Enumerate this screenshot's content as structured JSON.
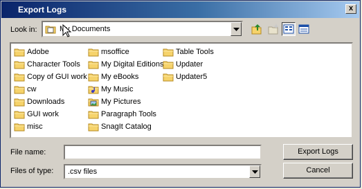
{
  "window": {
    "title": "Export Logs",
    "close_label": "x"
  },
  "lookin": {
    "label": "Look in:",
    "value": "My Documents"
  },
  "toolbar": {
    "icons": [
      "up-folder-icon",
      "new-folder-icon",
      "list-view-icon",
      "details-view-icon"
    ]
  },
  "files": [
    {
      "name": "Adobe",
      "icon": "folder-icon"
    },
    {
      "name": "Character Tools",
      "icon": "folder-icon"
    },
    {
      "name": "Copy of GUI work",
      "icon": "folder-icon"
    },
    {
      "name": "cw",
      "icon": "folder-icon"
    },
    {
      "name": "Downloads",
      "icon": "folder-icon"
    },
    {
      "name": "GUI work",
      "icon": "folder-icon"
    },
    {
      "name": "misc",
      "icon": "folder-icon"
    },
    {
      "name": "msoffice",
      "icon": "folder-icon"
    },
    {
      "name": "My Digital Editions",
      "icon": "folder-icon"
    },
    {
      "name": "My eBooks",
      "icon": "folder-icon"
    },
    {
      "name": "My Music",
      "icon": "music-folder-icon"
    },
    {
      "name": "My Pictures",
      "icon": "pictures-folder-icon"
    },
    {
      "name": "Paragraph Tools",
      "icon": "folder-icon"
    },
    {
      "name": "SnagIt Catalog",
      "icon": "folder-icon"
    },
    {
      "name": "Table Tools",
      "icon": "folder-icon"
    },
    {
      "name": "Updater",
      "icon": "folder-icon"
    },
    {
      "name": "Updater5",
      "icon": "folder-icon"
    }
  ],
  "file_name": {
    "label": "File name:",
    "value": ""
  },
  "file_type": {
    "label": "Files of type:",
    "value": ".csv files"
  },
  "buttons": {
    "export": "Export Logs",
    "cancel": "Cancel"
  }
}
